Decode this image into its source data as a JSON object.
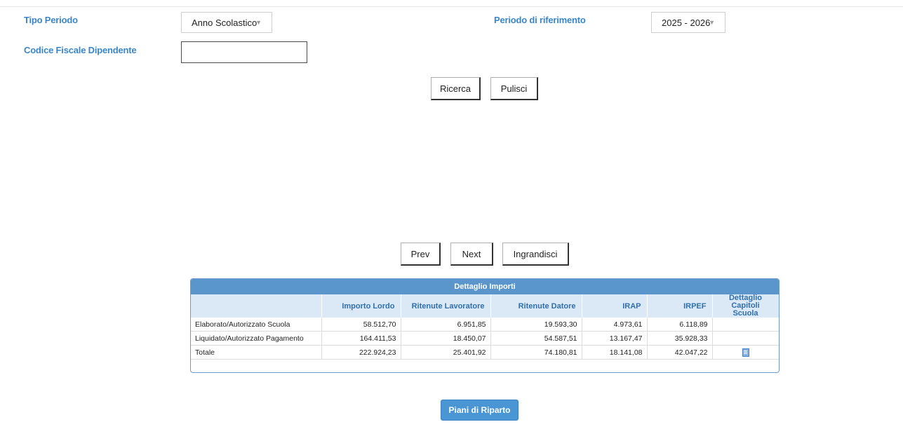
{
  "filters": {
    "tipo_periodo_label": "Tipo Periodo",
    "tipo_periodo_value": "Anno Scolastico",
    "periodo_riferimento_label": "Periodo di riferimento",
    "periodo_riferimento_value": "2025 - 2026",
    "codice_fiscale_label": "Codice Fiscale Dipendente",
    "codice_fiscale_value": ""
  },
  "actions": {
    "ricerca": "Ricerca",
    "pulisci": "Pulisci"
  },
  "pager": {
    "prev": "Prev",
    "next": "Next",
    "ingrandisci": "Ingrandisci"
  },
  "table": {
    "title": "Dettaglio Importi",
    "columns": [
      "",
      "Importo Lordo",
      "Ritenute Lavoratore",
      "Ritenute Datore",
      "IRAP",
      "IRPEF",
      "Dettaglio Capitoli Scuola"
    ],
    "rows": [
      {
        "label": "Elaborato/Autorizzato Scuola",
        "importo_lordo": "58.512,70",
        "ritenute_lavoratore": "6.951,85",
        "ritenute_datore": "19.593,30",
        "irap": "4.973,61",
        "irpef": "6.118,89",
        "dettaglio": ""
      },
      {
        "label": "Liquidato/Autorizzato Pagamento",
        "importo_lordo": "164.411,53",
        "ritenute_lavoratore": "18.450,07",
        "ritenute_datore": "54.587,51",
        "irap": "13.167,47",
        "irpef": "35.928,33",
        "dettaglio": ""
      },
      {
        "label": "Totale",
        "importo_lordo": "222.924,23",
        "ritenute_lavoratore": "25.401,92",
        "ritenute_datore": "74.180,81",
        "irap": "18.141,08",
        "irpef": "42.047,22",
        "dettaglio": "document-icon"
      }
    ]
  },
  "footer": {
    "piani_di_riparto": "Piani di Riparto"
  },
  "colors": {
    "label_blue": "#3a86c8",
    "header_blue": "#5a95cb",
    "subheader_bg": "#dbe9f6",
    "primary_button": "#4a95d4"
  }
}
